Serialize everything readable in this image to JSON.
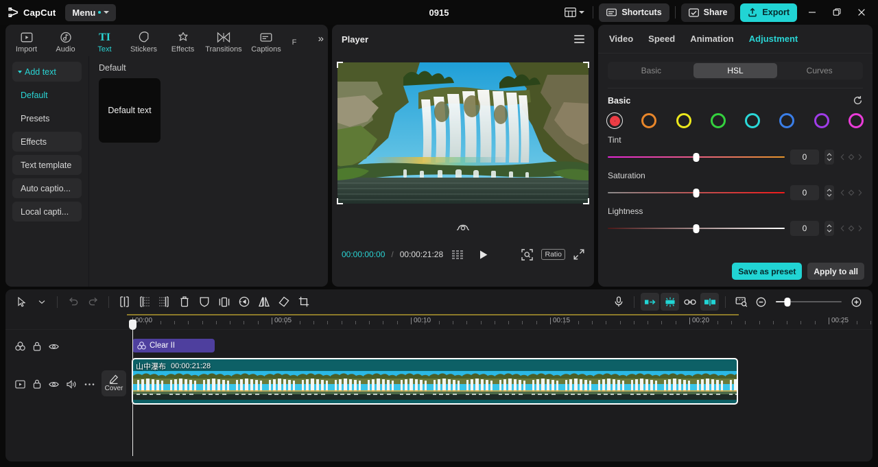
{
  "titlebar": {
    "brand": "CapCut",
    "menu_label": "Menu",
    "project_title": "0915",
    "shortcuts_label": "Shortcuts",
    "share_label": "Share",
    "export_label": "Export",
    "icons": {
      "layout": "layout-icon",
      "layout_chevron": "chevron-down-icon",
      "shortcuts": "keyboard-icon",
      "share": "share-icon",
      "export": "upload-icon",
      "minimize": "minimize-icon",
      "maximize": "maximize-icon",
      "close": "close-icon"
    }
  },
  "left_panel": {
    "tabs": [
      {
        "label": "Import",
        "icon": "import-icon",
        "active": false
      },
      {
        "label": "Audio",
        "icon": "audio-icon",
        "active": false
      },
      {
        "label": "Text",
        "icon": "text-icon",
        "active": true
      },
      {
        "label": "Stickers",
        "icon": "stickers-icon",
        "active": false
      },
      {
        "label": "Effects",
        "icon": "effects-icon",
        "active": false
      },
      {
        "label": "Transitions",
        "icon": "transitions-icon",
        "active": false
      },
      {
        "label": "Captions",
        "icon": "captions-icon",
        "active": false
      },
      {
        "label": "F",
        "icon": "filters-icon",
        "active": false
      }
    ],
    "expand_label": "»",
    "nav": [
      {
        "label": "Add text",
        "style": "add",
        "selected": false
      },
      {
        "label": "Default",
        "style": "plain",
        "selected": true
      },
      {
        "label": "Presets",
        "style": "plain",
        "selected": false
      },
      {
        "label": "Effects",
        "style": "boxed",
        "selected": false
      },
      {
        "label": "Text template",
        "style": "boxed",
        "selected": false
      },
      {
        "label": "Auto captio...",
        "style": "boxed",
        "selected": false
      },
      {
        "label": "Local capti...",
        "style": "boxed",
        "selected": false
      }
    ],
    "content_title": "Default",
    "text_card_label": "Default text"
  },
  "player": {
    "title": "Player",
    "menu_icon": "hamburger-icon",
    "reframe_icon": "reframe-icon",
    "current_time": "00:00:00:00",
    "time_separator": "/",
    "total_time": "00:00:21:28",
    "frames_icon": "frames-icon",
    "play_icon": "play-icon",
    "zoom_fit_icon": "zoom-fit-icon",
    "ratio_label": "Ratio",
    "fullscreen_icon": "fullscreen-icon"
  },
  "right_panel": {
    "tabs": [
      {
        "label": "Video",
        "active": false
      },
      {
        "label": "Speed",
        "active": false
      },
      {
        "label": "Animation",
        "active": false
      },
      {
        "label": "Adjustment",
        "active": true
      }
    ],
    "segments": [
      {
        "label": "Basic",
        "active": false
      },
      {
        "label": "HSL",
        "active": true
      },
      {
        "label": "Curves",
        "active": false
      }
    ],
    "section_title": "Basic",
    "reset_icon": "reset-icon",
    "swatches": [
      {
        "name": "red",
        "color": "#ec3c44",
        "selected": true
      },
      {
        "name": "orange",
        "color": "#e8862a",
        "selected": false
      },
      {
        "name": "yellow",
        "color": "#ece81c",
        "selected": false
      },
      {
        "name": "green",
        "color": "#34d13e",
        "selected": false
      },
      {
        "name": "cyan",
        "color": "#2ad8d8",
        "selected": false
      },
      {
        "name": "blue",
        "color": "#3a7ee8",
        "selected": false
      },
      {
        "name": "purple",
        "color": "#a03ce8",
        "selected": false
      },
      {
        "name": "magenta",
        "color": "#ea3cd8",
        "selected": false
      }
    ],
    "sliders": [
      {
        "label": "Tint",
        "value": "0",
        "pos": 50,
        "from": "#e626d8",
        "to": "#e8962a"
      },
      {
        "label": "Saturation",
        "value": "0",
        "pos": 50,
        "from": "#8a8a8a",
        "to": "#f01a1a"
      },
      {
        "label": "Lightness",
        "value": "0",
        "pos": 50,
        "from": "#4a1818",
        "to": "#ffffff"
      }
    ],
    "save_preset_label": "Save as preset",
    "apply_all_label": "Apply to all"
  },
  "timeline": {
    "tools_left": [
      {
        "name": "select-tool-icon",
        "state": "normal"
      },
      {
        "name": "tool-chevron-down-icon",
        "state": "normal"
      },
      {
        "name": "undo-icon",
        "state": "disabled"
      },
      {
        "name": "redo-icon",
        "state": "disabled"
      },
      {
        "name": "split-icon",
        "state": "normal"
      },
      {
        "name": "trim-left-icon",
        "state": "normal"
      },
      {
        "name": "trim-right-icon",
        "state": "normal"
      },
      {
        "name": "delete-icon",
        "state": "normal"
      },
      {
        "name": "mask-icon",
        "state": "normal"
      },
      {
        "name": "freeze-frame-icon",
        "state": "normal"
      },
      {
        "name": "reverse-icon",
        "state": "normal"
      },
      {
        "name": "mirror-icon",
        "state": "normal"
      },
      {
        "name": "rotate-icon",
        "state": "normal"
      },
      {
        "name": "crop-icon",
        "state": "normal"
      }
    ],
    "tools_right": [
      {
        "name": "record-voiceover-icon",
        "state": "normal"
      },
      {
        "name": "auto-snap-icon",
        "state": "active"
      },
      {
        "name": "magnetic-icon",
        "state": "active"
      },
      {
        "name": "link-icon",
        "state": "normal"
      },
      {
        "name": "adsorb-icon",
        "state": "active"
      },
      {
        "name": "preview-axis-icon",
        "state": "normal"
      },
      {
        "name": "zoom-out-icon",
        "state": "normal"
      },
      {
        "name": "zoom-in-icon",
        "state": "normal"
      }
    ],
    "zoom_value": 18,
    "ruler_labels": [
      "00:00",
      "00:05",
      "00:10",
      "00:15",
      "00:20",
      "00:25"
    ],
    "playhead_time": "00:00",
    "track_adjustment": {
      "icons": [
        "adjustment-icon",
        "lock-icon",
        "eye-icon"
      ],
      "clip_label": "Clear II",
      "clip_icon": "adjustment-icon"
    },
    "track_video": {
      "icons": [
        "video-icon",
        "lock-icon",
        "eye-icon",
        "volume-icon",
        "more-icon"
      ],
      "cover_label": "Cover",
      "cover_icon": "pencil-icon",
      "clip_name": "山中瀑布",
      "clip_duration": "00:00:21:28"
    }
  }
}
